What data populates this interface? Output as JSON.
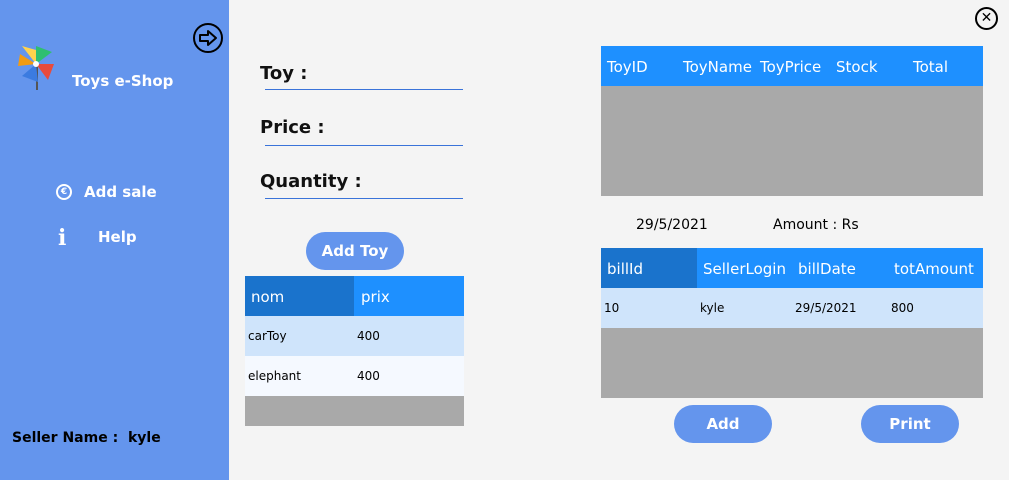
{
  "sidebar": {
    "app_title": "Toys e-Shop",
    "nav": [
      {
        "label": "Add sale",
        "icon": "euro-icon"
      },
      {
        "label": "Help",
        "icon": "info-icon"
      }
    ],
    "seller_label": "Seller Name :",
    "seller_name": "kyle",
    "color": "#6495ed"
  },
  "form": {
    "toy_label": "Toy :",
    "price_label": "Price :",
    "quantity_label": "Quantity :",
    "toy_value": "",
    "price_value": "",
    "quantity_value": "",
    "add_button": "Add Toy"
  },
  "toys_grid": {
    "columns": [
      "nom",
      "prix"
    ],
    "rows": [
      {
        "nom": "carToy",
        "prix": "400"
      },
      {
        "nom": "elephant",
        "prix": "400"
      }
    ]
  },
  "cart_grid": {
    "columns": [
      "ToyID",
      "ToyName",
      "ToyPrice",
      "Stock",
      "Total"
    ],
    "rows": []
  },
  "summary": {
    "date": "29/5/2021",
    "amount_label": "Amount : Rs"
  },
  "bills_grid": {
    "columns": [
      "billId",
      "SellerLogin",
      "billDate",
      "totAmount"
    ],
    "rows": [
      {
        "billId": "10",
        "SellerLogin": "kyle",
        "billDate": "29/5/2021",
        "totAmount": "800"
      }
    ]
  },
  "actions": {
    "add_button": "Add",
    "print_button": "Print"
  },
  "colors": {
    "accent": "#6495ed",
    "grid_header": "#1e90ff",
    "grid_header_selected": "#1a73cc",
    "grid_background": "#a9a9a9",
    "row_selected": "#cfe4fb",
    "row_alt": "#f5f9ff"
  }
}
